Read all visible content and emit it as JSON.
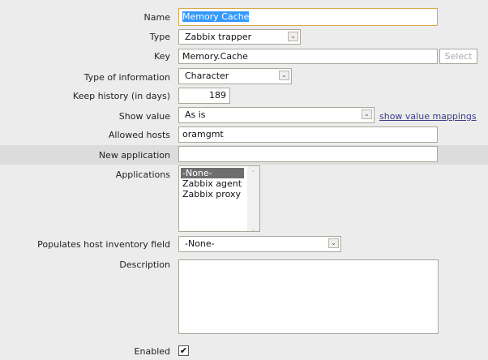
{
  "fields": {
    "name": {
      "label": "Name",
      "value": "Memory Cache"
    },
    "type": {
      "label": "Type",
      "value": "Zabbix trapper"
    },
    "key": {
      "label": "Key",
      "value": "Memory.Cache",
      "button": "Select"
    },
    "info": {
      "label": "Type of information",
      "value": "Character"
    },
    "history": {
      "label": "Keep history (in days)",
      "value": "189"
    },
    "show": {
      "label": "Show value",
      "value": "As is",
      "link": "show value mappings"
    },
    "hosts": {
      "label": "Allowed hosts",
      "value": "oramgmt"
    },
    "newapp": {
      "label": "New application",
      "value": ""
    },
    "apps": {
      "label": "Applications",
      "options": [
        "-None-",
        "Zabbix agent",
        "Zabbix proxy"
      ]
    },
    "inventory": {
      "label": "Populates host inventory field",
      "value": "-None-"
    },
    "description": {
      "label": "Description",
      "value": ""
    },
    "enabled": {
      "label": "Enabled",
      "checked": true
    }
  }
}
